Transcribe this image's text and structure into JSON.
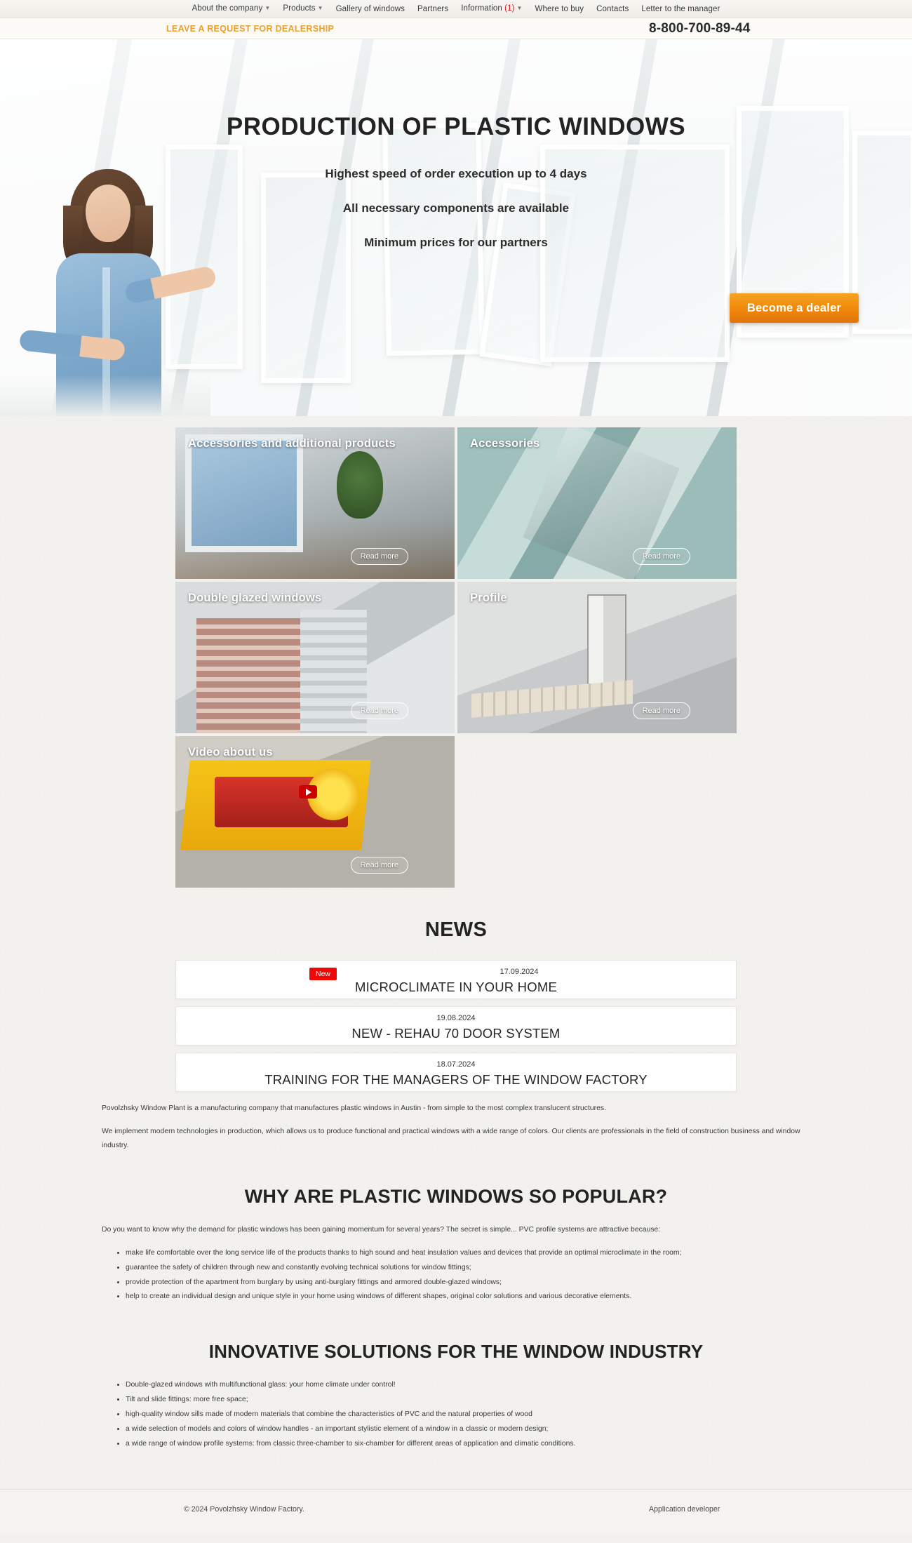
{
  "nav": {
    "items": [
      {
        "label": "About the company",
        "has_caret": true
      },
      {
        "label": "Products",
        "has_caret": true
      },
      {
        "label": "Gallery of windows",
        "has_caret": false
      },
      {
        "label": "Partners",
        "has_caret": false
      },
      {
        "label": "Information",
        "count": "(1)",
        "has_caret": true
      },
      {
        "label": "Where to buy",
        "has_caret": false
      },
      {
        "label": "Contacts",
        "has_caret": false
      },
      {
        "label": "Letter to the manager",
        "has_caret": false
      }
    ]
  },
  "header": {
    "dealership_link": "LEAVE A REQUEST FOR DEALERSHIP",
    "phone": "8-800-700-89-44",
    "accent_color": "#eaa02c"
  },
  "hero": {
    "title": "PRODUCTION OF PLASTIC WINDOWS",
    "sub1": "Highest speed of order execution up to 4 days",
    "sub2": "All necessary components are available",
    "sub3": "Minimum prices for our partners",
    "cta": "Become a dealer",
    "cta_color": "#f08a0b"
  },
  "cards": [
    {
      "title": "Accessories and additional products",
      "read_more": "Read more"
    },
    {
      "title": "Accessories",
      "read_more": "Read more"
    },
    {
      "title": "Double glazed windows",
      "read_more": "Read more"
    },
    {
      "title": "Profile",
      "read_more": "Read more"
    },
    {
      "title": "Video about us",
      "read_more": "Read more"
    }
  ],
  "news": {
    "heading": "NEWS",
    "items": [
      {
        "badge": "New",
        "date": "17.09.2024",
        "headline": "MICROCLIMATE IN YOUR HOME"
      },
      {
        "badge": null,
        "date": "19.08.2024",
        "headline": "NEW - REHAU 70 DOOR SYSTEM"
      },
      {
        "badge": null,
        "date": "18.07.2024",
        "headline": "TRAINING FOR THE MANAGERS OF THE WINDOW FACTORY"
      }
    ],
    "badge_color": "#ef0808"
  },
  "about": {
    "p1": "Povolzhsky Window Plant is a manufacturing company that manufactures plastic windows in Austin - from simple to the most complex translucent structures.",
    "p2": "We implement modern technologies in production, which allows us to produce functional and practical windows with a wide range of colors. Our clients are professionals in the field of construction business and window industry."
  },
  "popular": {
    "heading": "WHY ARE PLASTIC WINDOWS SO POPULAR?",
    "intro": "Do you want to know why the demand for plastic windows has been gaining momentum for several years? The secret is simple... PVC profile systems are attractive because:",
    "bullets": [
      "make life comfortable over the long service life of the products thanks to high sound and heat insulation values and devices that provide an optimal microclimate in the room;",
      "guarantee the safety of children through new and constantly evolving technical solutions for window fittings;",
      "provide protection of the apartment from burglary by using anti-burglary fittings and armored double-glazed windows;",
      "help to create an individual design and unique style in your home using windows of different shapes, original color solutions and various decorative elements."
    ]
  },
  "innovative": {
    "heading": "INNOVATIVE SOLUTIONS FOR THE WINDOW INDUSTRY",
    "bullets": [
      "Double-glazed windows with multifunctional glass: your home climate under control!",
      "Tilt and slide fittings: more free space;",
      "high-quality window sills made of modern materials that combine the characteristics of PVC and the natural properties of wood",
      "a wide selection of models and colors of window handles - an important stylistic element of a window in a classic or modern design;",
      "a wide range of window profile systems: from classic three-chamber to six-chamber for different areas of application and climatic conditions."
    ]
  },
  "footer": {
    "copyright": "© 2024 Povolzhsky Window Factory.",
    "developer": "Application developer"
  }
}
